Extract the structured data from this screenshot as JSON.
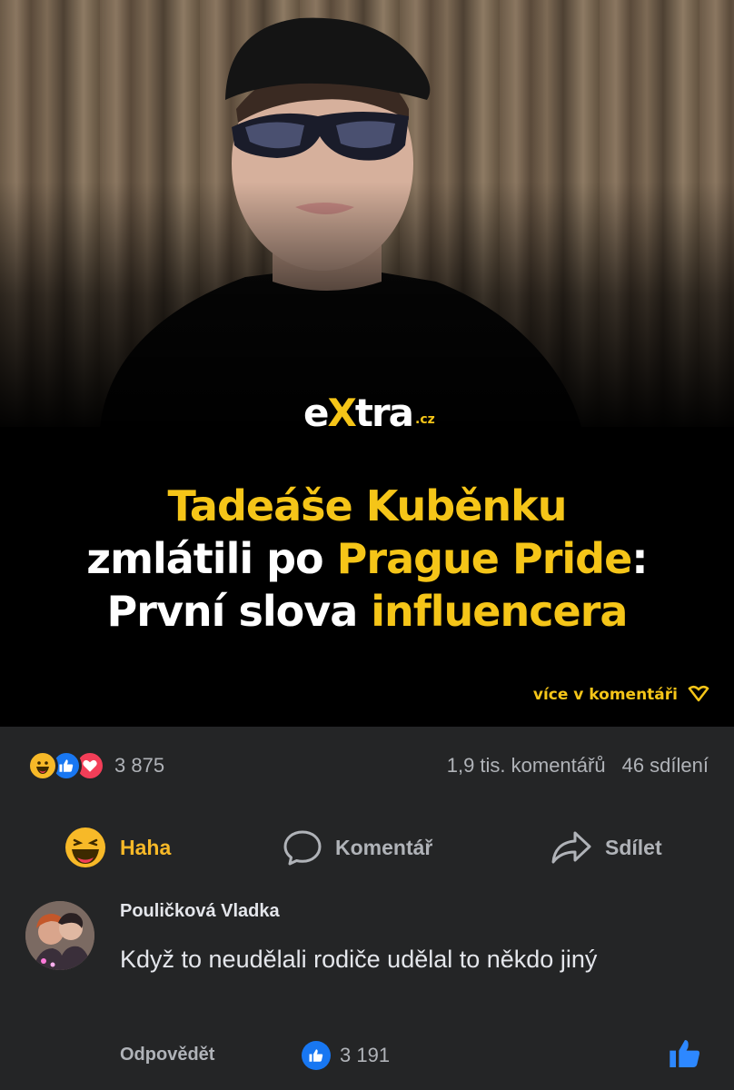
{
  "post": {
    "logo": {
      "main_e": "e",
      "main_x": "X",
      "main_rest": "tra",
      "suffix": ".cz"
    },
    "headline": {
      "line1": "Tadeáše Kuběnku",
      "line2_a": "zmlátili po ",
      "line2_b": "Prague Pride",
      "line2_c": ":",
      "line3_a": "První slova ",
      "line3_b": "influencera"
    },
    "more_link": "více v komentáři",
    "colors": {
      "accent": "#f5c518",
      "background": "#242526",
      "like_blue": "#1877f2",
      "love_red": "#f33e58",
      "haha_yellow": "#f7b928"
    }
  },
  "stats": {
    "reaction_icons": [
      "haha-icon",
      "like-icon",
      "love-icon"
    ],
    "reaction_count": "3 875",
    "comments": "1,9 tis. komentářů",
    "shares": "46 sdílení"
  },
  "actions": {
    "haha": "Haha",
    "comment": "Komentář",
    "share": "Sdílet"
  },
  "comment": {
    "author": "Pouličková Vladka",
    "text": "Když to neudělali rodiče udělal to někdo jiný",
    "reply": "Odpovědět",
    "like_count": "3 191"
  }
}
